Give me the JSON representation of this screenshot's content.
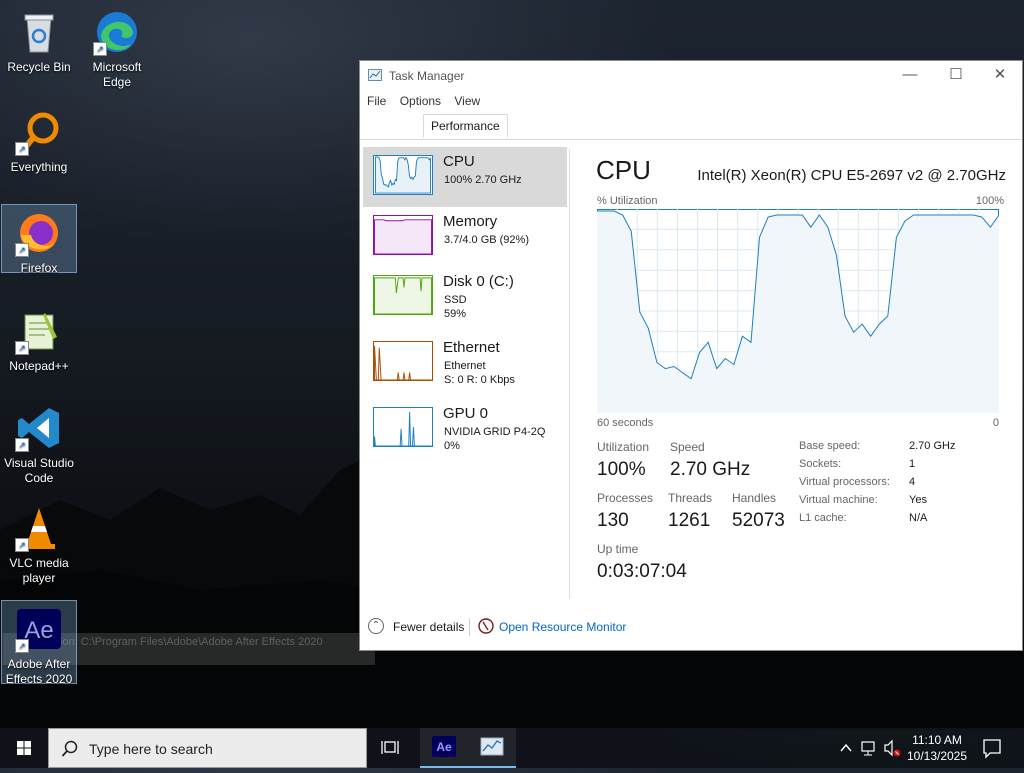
{
  "desktop": {
    "icons": [
      {
        "label": "Recycle Bin"
      },
      {
        "label": "Microsoft Edge"
      },
      {
        "label": "Everything"
      },
      {
        "label": "Firefox"
      },
      {
        "label": "Notepad++"
      },
      {
        "label": "Visual Studio Code"
      },
      {
        "label": "VLC media player"
      },
      {
        "label": "Adobe After Effects 2020"
      }
    ],
    "tooltip": "Location: C:\\Program Files\\Adobe\\Adobe After Effects 2020"
  },
  "window": {
    "title": "Task Manager",
    "menu": [
      "File",
      "Options",
      "View"
    ],
    "active_tab": "Performance",
    "controls": {
      "minimize": "—",
      "maximize": "☐",
      "close": "✕"
    }
  },
  "perf_items": [
    {
      "name": "CPU",
      "line1": "100%  2.70 GHz",
      "line2": "",
      "color": "#1f7fbf"
    },
    {
      "name": "Memory",
      "line1": "3.7/4.0 GB (92%)",
      "line2": "",
      "color": "#8b12ae"
    },
    {
      "name": "Disk 0 (C:)",
      "line1": "SSD",
      "line2": "59%",
      "color": "#4da60c"
    },
    {
      "name": "Ethernet",
      "line1": "Ethernet",
      "line2": "S: 0  R: 0 Kbps",
      "color": "#a74f01"
    },
    {
      "name": "GPU 0",
      "line1": "NVIDIA GRID P4-2Q",
      "line2": "0%",
      "color": "#1f7fbf"
    }
  ],
  "cpu": {
    "title": "CPU",
    "model": "Intel(R) Xeon(R) CPU E5-2697 v2 @ 2.70GHz",
    "util_label": "% Utilization",
    "util_max": "100%",
    "x_left": "60 seconds",
    "x_right": "0",
    "utilization_label": "Utilization",
    "utilization": "100%",
    "speed_label": "Speed",
    "speed": "2.70 GHz",
    "processes_label": "Processes",
    "processes": "130",
    "threads_label": "Threads",
    "threads": "1261",
    "handles_label": "Handles",
    "handles": "52073",
    "uptime_label": "Up time",
    "uptime": "0:03:07:04",
    "specs": [
      {
        "k": "Base speed:",
        "v": "2.70 GHz"
      },
      {
        "k": "Sockets:",
        "v": "1"
      },
      {
        "k": "Virtual processors:",
        "v": "4"
      },
      {
        "k": "Virtual machine:",
        "v": "Yes"
      },
      {
        "k": "L1 cache:",
        "v": "N/A"
      }
    ],
    "history": [
      100,
      100,
      100,
      98,
      90,
      50,
      42,
      25,
      22,
      23,
      20,
      17,
      30,
      35,
      22,
      27,
      24,
      38,
      35,
      87,
      97,
      98,
      98,
      98,
      98,
      92,
      98,
      92,
      78,
      48,
      40,
      44,
      38,
      44,
      48,
      87,
      95,
      98,
      98,
      98,
      98,
      98,
      98,
      98,
      98,
      97,
      92,
      98
    ]
  },
  "footer": {
    "fewer_details": "Fewer details",
    "resource_monitor": "Open Resource Monitor"
  },
  "taskbar": {
    "search_placeholder": "Type here to search",
    "time": "11:10 AM",
    "date": "10/13/2025",
    "ae_label": "Ae"
  }
}
